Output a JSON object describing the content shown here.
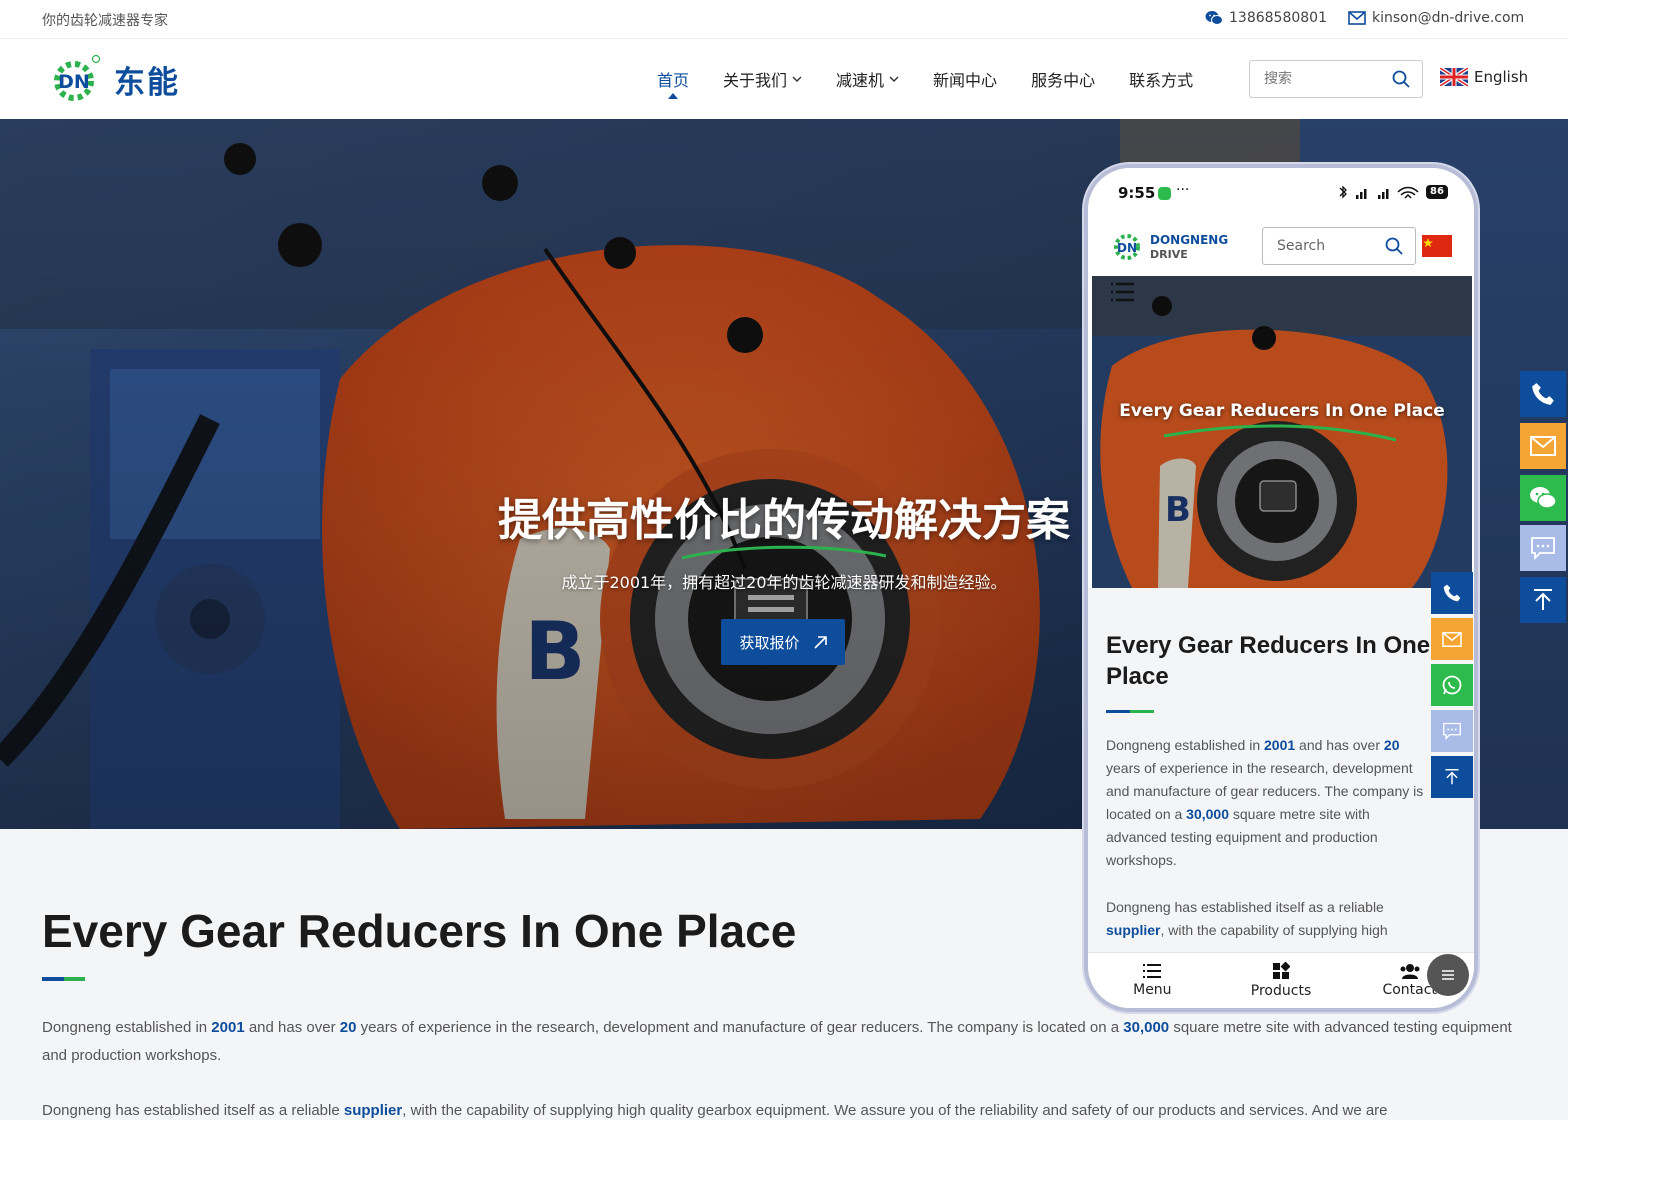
{
  "topbar": {
    "slogan": "你的齿轮减速器专家",
    "phone": "13868580801",
    "email": "kinson@dn-drive.com"
  },
  "header": {
    "logo_text": "东能",
    "nav": [
      {
        "label": "首页",
        "active": true,
        "dropdown": false
      },
      {
        "label": "关于我们",
        "active": false,
        "dropdown": true
      },
      {
        "label": "减速机",
        "active": false,
        "dropdown": true
      },
      {
        "label": "新闻中心",
        "active": false,
        "dropdown": false
      },
      {
        "label": "服务中心",
        "active": false,
        "dropdown": false
      },
      {
        "label": "联系方式",
        "active": false,
        "dropdown": false
      }
    ],
    "search_placeholder": "搜索",
    "language": "English"
  },
  "hero": {
    "title": "提供高性价比的传动解决方案",
    "subtitle": "成立于2001年，拥有超过20年的齿轮减速器研发和制造经验。",
    "cta": "获取报价"
  },
  "about": {
    "heading": "Every Gear Reducers In One Place",
    "p1": {
      "t1": "Dongneng established in ",
      "year": "2001",
      "t2": " and has over ",
      "years": "20",
      "t3": " years of experience in the research, development and manufacture of gear reducers. The company is located on a ",
      "area": "30,000",
      "t4": " square metre site with advanced testing equipment and production workshops."
    },
    "p2": {
      "t1": "Dongneng has established itself as a reliable ",
      "supplier": "supplier",
      "t2": ", with the capability of supplying high quality gearbox equipment. We assure you of the reliability and safety of our products and services. And we are"
    }
  },
  "colors": {
    "brand_blue": "#0e4d9c",
    "brand_green": "#2bb24c",
    "accent_orange": "#f5a533",
    "chat_green": "#2dbb4e",
    "chat_lilac": "#a9bce8"
  },
  "side_tools": [
    "phone-icon",
    "mail-icon",
    "wechat-icon",
    "chat-icon",
    "back-to-top-icon"
  ],
  "mobile": {
    "time": "9:55",
    "battery": "86",
    "logo_line1": "DONGNENG",
    "logo_line2": "DRIVE",
    "search_placeholder": "Search",
    "hero_title": "Every Gear Reducers In One Place",
    "heading_line1": "Every Gear Reducers In One",
    "heading_line2": "Place",
    "p1": {
      "l1a": "Dongneng established in ",
      "l1b": "2001",
      "l1c": " and has over ",
      "l1d": "20",
      "l2": "years of experience in the research, development",
      "l3": "and manufacture of gear reducers. The company is",
      "l4a": "located on a ",
      "l4b": "30,000",
      "l4c": " square metre site with",
      "l5": "advanced testing equipment and production",
      "l6": "workshops."
    },
    "p2": {
      "l1": "Dongneng has established itself as a reliable",
      "l2a": "supplier",
      "l2b": ", with the capability of supplying high"
    },
    "bottom_nav": [
      "Menu",
      "Products",
      "Contact"
    ]
  }
}
